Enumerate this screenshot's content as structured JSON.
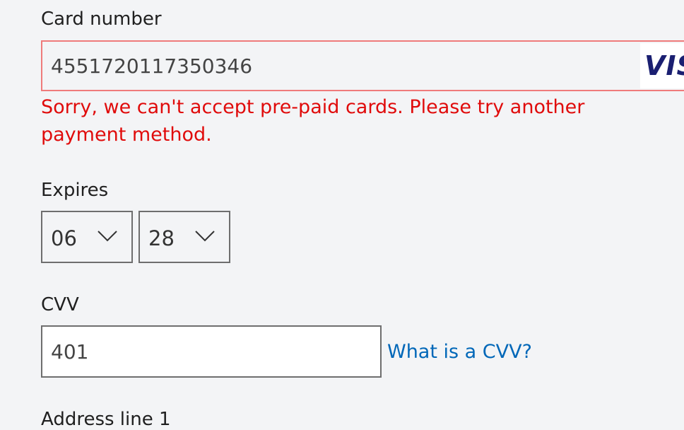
{
  "card_number": {
    "label": "Card number",
    "value": "4551720117350346",
    "brand": "VISA",
    "brand_color": "#1a1f71",
    "error": "Sorry, we can't accept pre-paid cards. Please try another payment method.",
    "error_color": "#e00b0b"
  },
  "expires": {
    "label": "Expires",
    "month": "06",
    "year": "28"
  },
  "cvv": {
    "label": "CVV",
    "value": "401",
    "help_link": "What is a CVV?",
    "link_color": "#0067b8"
  },
  "address": {
    "label": "Address line 1"
  }
}
